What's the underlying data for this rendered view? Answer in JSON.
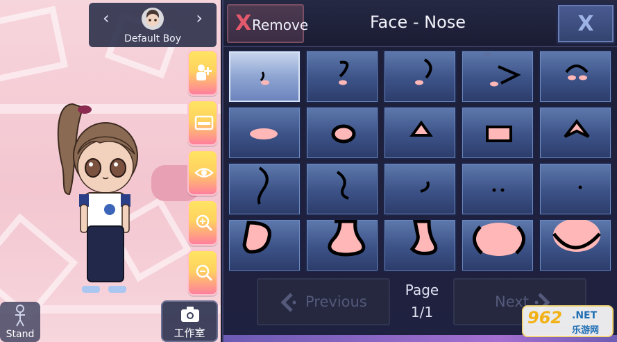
{
  "character": {
    "name": "Default Boy",
    "prev_arrow": "‹",
    "next_arrow": "›"
  },
  "side_toolbar": [
    {
      "icon": "add-character-icon"
    },
    {
      "icon": "background-icon"
    },
    {
      "icon": "eye-visibility-icon"
    },
    {
      "icon": "zoom-in-icon"
    },
    {
      "icon": "zoom-out-icon"
    }
  ],
  "bottom_left": {
    "stand_label": "Stand",
    "studio_label": "工作室"
  },
  "panel": {
    "remove_icon": "X",
    "remove_label": "Remove",
    "title": "Face - Nose",
    "close_label": "X"
  },
  "nose_grid": {
    "selected_index": 0,
    "items": [
      "nose-style-1",
      "nose-style-2",
      "nose-style-3",
      "nose-style-4",
      "nose-style-5",
      "nose-style-6",
      "nose-style-7",
      "nose-style-8",
      "nose-style-9",
      "nose-style-10",
      "nose-style-11",
      "nose-style-12",
      "nose-style-13",
      "nose-style-14",
      "nose-style-15",
      "nose-style-16",
      "nose-style-17",
      "nose-style-18",
      "nose-style-19",
      "nose-style-20"
    ]
  },
  "pagination": {
    "previous_label": "Previous",
    "next_label": "Next",
    "page_label": "Page",
    "page_value": "1/1"
  },
  "watermark": {
    "number": "962",
    "net": ".NET",
    "site": "乐游网"
  },
  "colors": {
    "side_button_top": "#ffe463",
    "side_button_bottom": "#ff7f9c",
    "cell_blue": "#3c5287",
    "nose_pink": "#ffb7b7",
    "panel_bg": "#1d1f38",
    "remove_x": "#e45a6c"
  }
}
